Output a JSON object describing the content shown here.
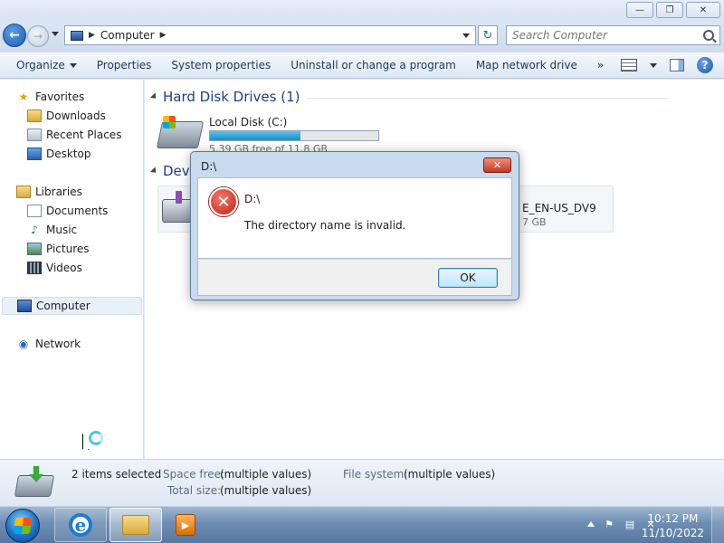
{
  "window": {
    "minimize_glyph": "—",
    "maximize_glyph": "❐",
    "close_glyph": "✕"
  },
  "address": {
    "back_glyph": "←",
    "forward_glyph": "→",
    "separator_glyph": "▶",
    "crumb": "Computer",
    "refresh_glyph": "↻",
    "search_placeholder": "Search Computer"
  },
  "commands": {
    "organize": "Organize",
    "properties": "Properties",
    "system_properties": "System properties",
    "uninstall": "Uninstall or change a program",
    "map_drive": "Map network drive",
    "more": "»",
    "help": "?"
  },
  "nav": {
    "favorites": "Favorites",
    "downloads": "Downloads",
    "recent_places": "Recent Places",
    "desktop": "Desktop",
    "libraries": "Libraries",
    "documents": "Documents",
    "music": "Music",
    "pictures": "Pictures",
    "videos": "Videos",
    "computer": "Computer",
    "network": "Network",
    "star_glyph": "★",
    "music_glyph": "♪",
    "network_glyph": "◉"
  },
  "content": {
    "hdd_header": "Hard Disk Drives (1)",
    "dev_header": "Devi",
    "local_disk_name": "Local Disk (C:)",
    "local_disk_free": "5.39 GB free of 11.8 GB",
    "local_disk_used_fraction": 0.54,
    "device_name": "E_EN-US_DV9",
    "device_size": "7 GB"
  },
  "details": {
    "count": "2 items selected",
    "space_free_label": "Space free:",
    "space_free_value": "(multiple values)",
    "total_size_label": "Total size:",
    "total_size_value": "(multiple values)",
    "file_system_label": "File system:",
    "file_system_value": "(multiple values)"
  },
  "dialog": {
    "title": "D:\\",
    "close_glyph": "✕",
    "error_glyph": "✕",
    "heading": "D:\\",
    "message": "The directory name is invalid.",
    "ok": "OK"
  },
  "taskbar": {
    "ie_glyph": "e",
    "mp_glyph": "▶",
    "flag_glyph": "⚑",
    "network_glyph": "▤",
    "volume_glyph": "✕",
    "time": "10:12 PM",
    "date": "11/10/2022"
  },
  "colors": {
    "accent": "#1e3e82",
    "error": "#c41d12",
    "progress": "#1a8bc6"
  }
}
